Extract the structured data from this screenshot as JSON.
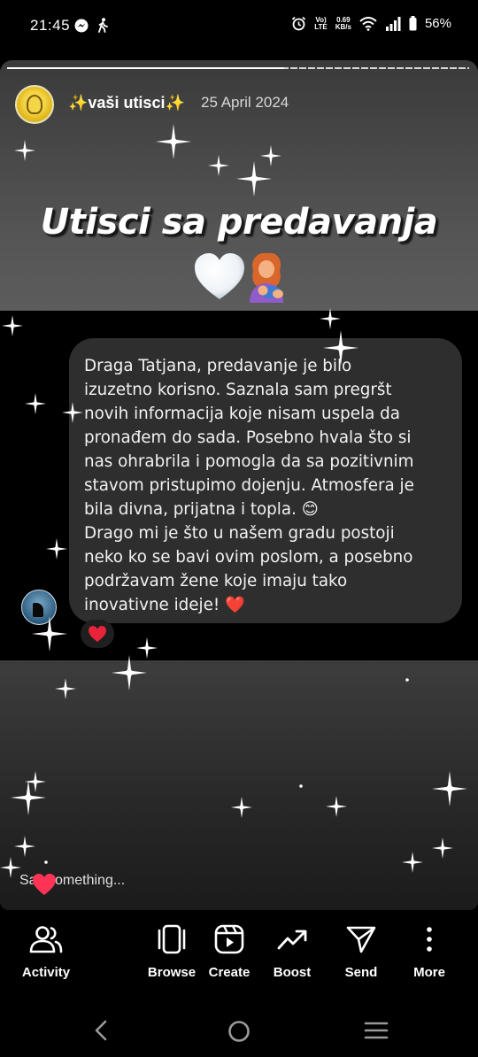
{
  "status_bar": {
    "time": "21:45",
    "net_speed_value": "0.69",
    "net_speed_unit": "KB/s",
    "battery": "56%",
    "icons": [
      "messenger-icon",
      "walking-icon",
      "alarm-icon",
      "volte-icon",
      "wifi-icon",
      "signal-icon",
      "battery-icon"
    ]
  },
  "story": {
    "progress_fraction": 0.6,
    "username": "✨vaši utisci✨",
    "date": "25 April 2024",
    "headline": "Utisci sa predavanja",
    "comment_text": "Draga Tatjana, predavanje je bilo\nizuzetno korisno. Saznala sam pregršt\nnovih informacija koje nisam uspela da\npronađem do sada. Posebno hvala što si\nnas ohrabrila i pomogla da sa pozitivnim\nstavom pristupimo dojenju. Atmosfera je\nbila divna, prijatna i topla. 😊\nDrago mi je što u našem gradu postoji\nneko ko se bavi ovim poslom, a posebno\npodržavam žene koje imaju tako\ninovativne ideje! ❤️",
    "reaction": "❤️",
    "reply_placeholder": "Say something..."
  },
  "actions": [
    {
      "label": "Activity",
      "icon": "activity-icon"
    },
    {
      "label": "Browse",
      "icon": "browse-icon"
    },
    {
      "label": "Create",
      "icon": "create-icon"
    },
    {
      "label": "Boost",
      "icon": "boost-icon"
    },
    {
      "label": "Send",
      "icon": "send-icon"
    },
    {
      "label": "More",
      "icon": "more-icon"
    }
  ],
  "nav": [
    "back-icon",
    "home-icon",
    "recents-icon"
  ],
  "colors": {
    "background": "#000000",
    "bubble": "#2e2e2e",
    "heart_red": "#e8233a",
    "username_sparkle": "#f6cf3a"
  }
}
